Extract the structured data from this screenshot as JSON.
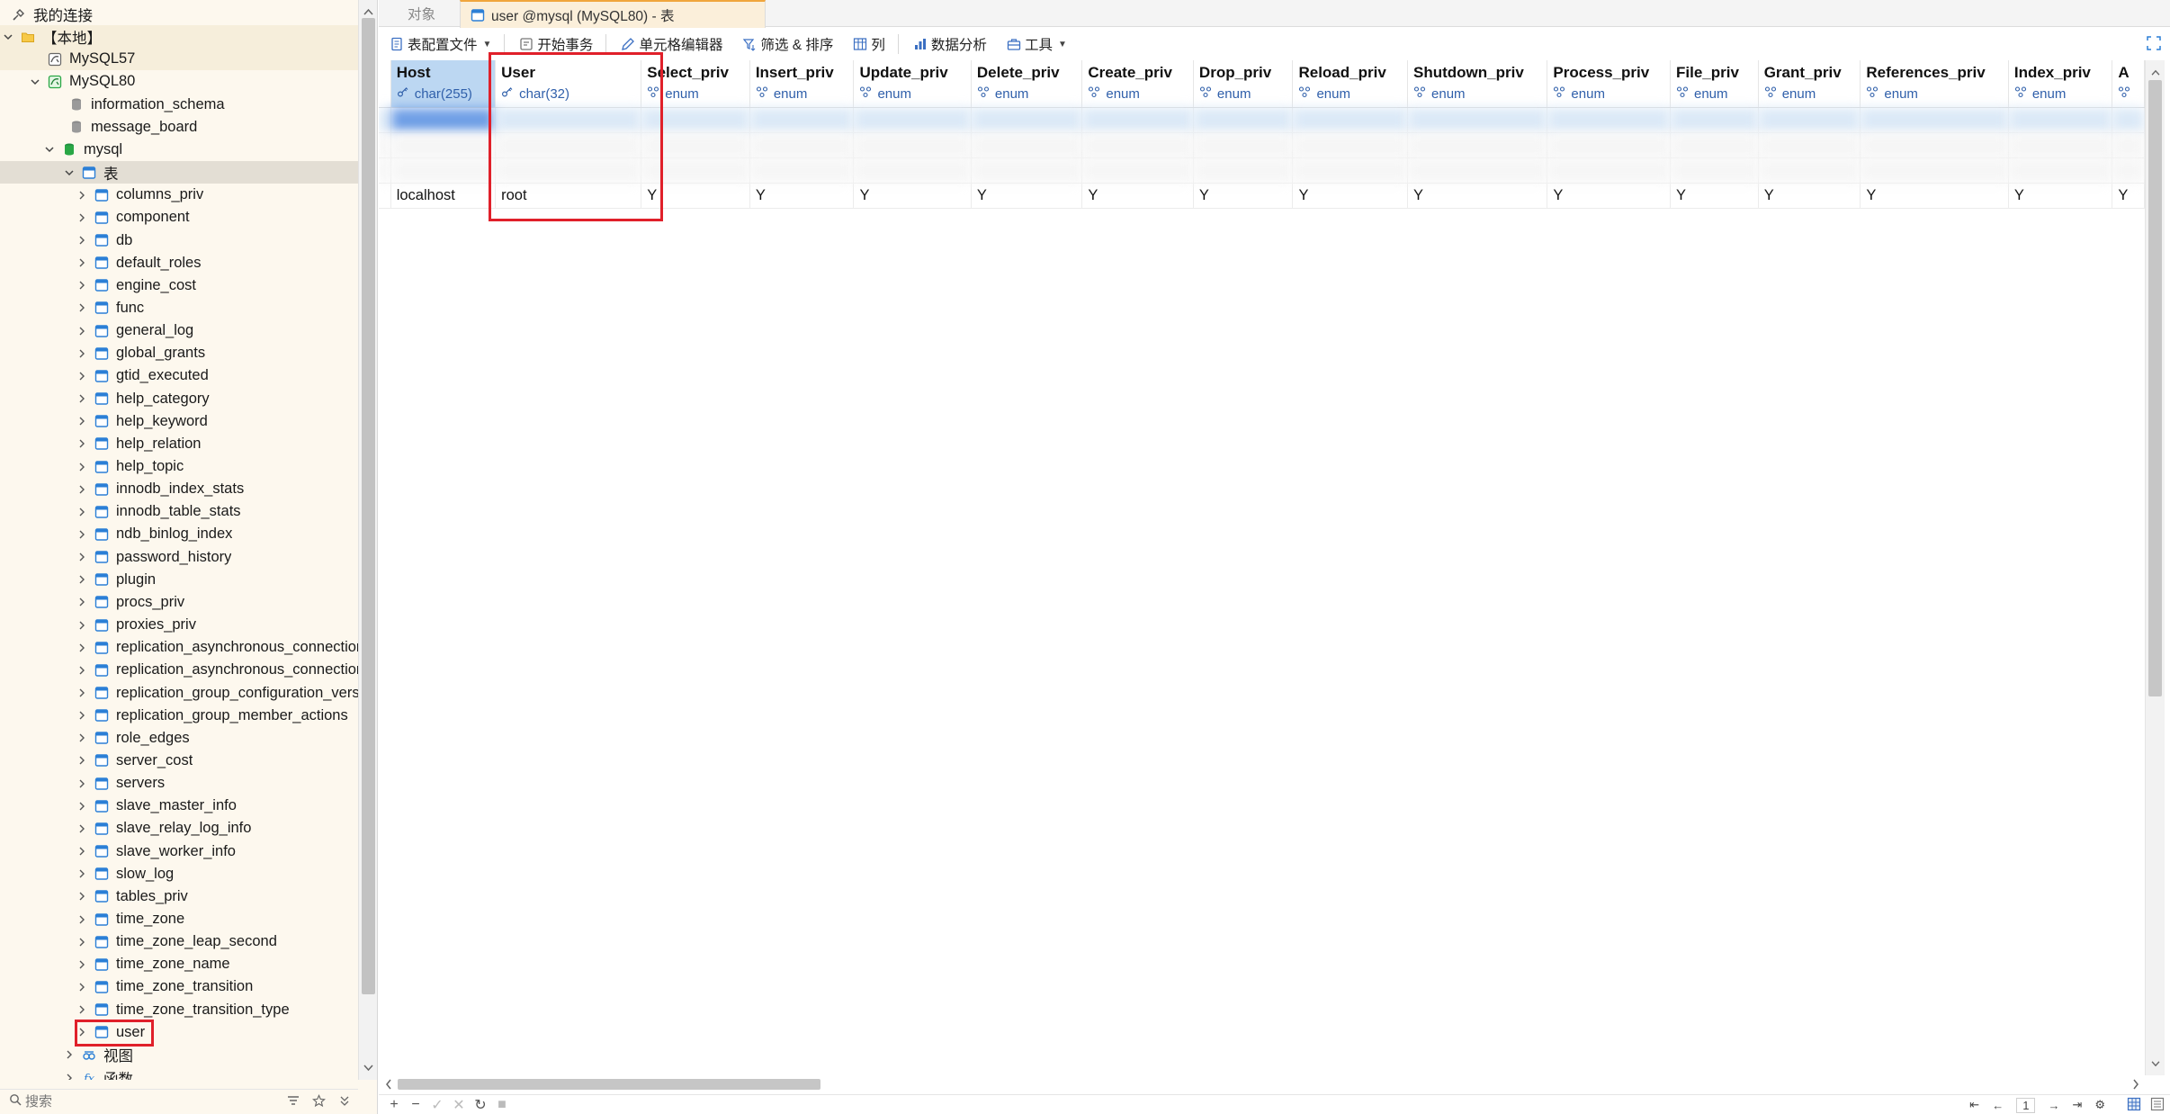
{
  "nav": {
    "header": "我的连接",
    "nodes": [
      {
        "label": "【本地】",
        "icon": "folder-icon",
        "level": 0,
        "expanded": true
      },
      {
        "label": "MySQL57",
        "icon": "mysql-connection-icon",
        "level": 1,
        "expanded": false
      },
      {
        "label": "MySQL80",
        "icon": "mysql-connection-active-icon",
        "level": 1,
        "expanded": true
      },
      {
        "label": "information_schema",
        "icon": "database-icon",
        "level": 2
      },
      {
        "label": "message_board",
        "icon": "database-icon",
        "level": 2
      },
      {
        "label": "mysql",
        "icon": "database-open-icon",
        "level": 2,
        "expanded": true
      },
      {
        "label": "表",
        "icon": "tables-folder-icon",
        "level": 3,
        "expanded": true,
        "selected": true
      }
    ],
    "tables": [
      "columns_priv",
      "component",
      "db",
      "default_roles",
      "engine_cost",
      "func",
      "general_log",
      "global_grants",
      "gtid_executed",
      "help_category",
      "help_keyword",
      "help_relation",
      "help_topic",
      "innodb_index_stats",
      "innodb_table_stats",
      "ndb_binlog_index",
      "password_history",
      "plugin",
      "procs_priv",
      "proxies_priv",
      "replication_asynchronous_connection_failover",
      "replication_asynchronous_connection_failover_managed",
      "replication_group_configuration_version",
      "replication_group_member_actions",
      "role_edges",
      "server_cost",
      "servers",
      "slave_master_info",
      "slave_relay_log_info",
      "slave_worker_info",
      "slow_log",
      "tables_priv",
      "time_zone",
      "time_zone_leap_second",
      "time_zone_name",
      "time_zone_transition",
      "time_zone_transition_type",
      "user"
    ],
    "after": [
      {
        "label": "视图",
        "icon": "views-icon"
      },
      {
        "label": "函数",
        "icon": "function-icon"
      }
    ],
    "search_placeholder": "搜索"
  },
  "tabs": [
    {
      "label": "对象",
      "active": false
    },
    {
      "label": "user @mysql (MySQL80) - 表",
      "active": true
    }
  ],
  "toolbar": [
    {
      "label": "表配置文件",
      "icon": "profile-icon",
      "dropdown": true
    },
    {
      "label": "开始事务",
      "icon": "transaction-icon"
    },
    {
      "label": "单元格编辑器",
      "icon": "cell-editor-icon"
    },
    {
      "label": "筛选 & 排序",
      "icon": "filter-sort-icon"
    },
    {
      "label": "列",
      "icon": "columns-icon"
    },
    {
      "label": "数据分析",
      "icon": "data-analysis-icon"
    },
    {
      "label": "工具",
      "icon": "tools-icon",
      "dropdown": true
    }
  ],
  "grid": {
    "columns": [
      {
        "name": "Host",
        "type": "char(255)",
        "type_icon": "key-icon"
      },
      {
        "name": "User",
        "type": "char(32)",
        "type_icon": "key-icon"
      },
      {
        "name": "Select_priv",
        "type": "enum",
        "type_icon": "enum-icon"
      },
      {
        "name": "Insert_priv",
        "type": "enum",
        "type_icon": "enum-icon"
      },
      {
        "name": "Update_priv",
        "type": "enum",
        "type_icon": "enum-icon"
      },
      {
        "name": "Delete_priv",
        "type": "enum",
        "type_icon": "enum-icon"
      },
      {
        "name": "Create_priv",
        "type": "enum",
        "type_icon": "enum-icon"
      },
      {
        "name": "Drop_priv",
        "type": "enum",
        "type_icon": "enum-icon"
      },
      {
        "name": "Reload_priv",
        "type": "enum",
        "type_icon": "enum-icon"
      },
      {
        "name": "Shutdown_priv",
        "type": "enum",
        "type_icon": "enum-icon"
      },
      {
        "name": "Process_priv",
        "type": "enum",
        "type_icon": "enum-icon"
      },
      {
        "name": "File_priv",
        "type": "enum",
        "type_icon": "enum-icon"
      },
      {
        "name": "Grant_priv",
        "type": "enum",
        "type_icon": "enum-icon"
      },
      {
        "name": "References_priv",
        "type": "enum",
        "type_icon": "enum-icon"
      },
      {
        "name": "Index_priv",
        "type": "enum",
        "type_icon": "enum-icon"
      },
      {
        "name": "A",
        "type": "",
        "type_icon": "enum-icon"
      }
    ],
    "visible_row": [
      "localhost",
      "root",
      "Y",
      "Y",
      "Y",
      "Y",
      "Y",
      "Y",
      "Y",
      "Y",
      "Y",
      "Y",
      "Y",
      "Y",
      "Y",
      "Y"
    ]
  },
  "status": {
    "page": "1"
  },
  "colors": {
    "highlight_box": "#e0202a",
    "nav_background": "#fdf8ee",
    "header_selected": "#bcd7f2",
    "type_text": "#2f5faa"
  }
}
